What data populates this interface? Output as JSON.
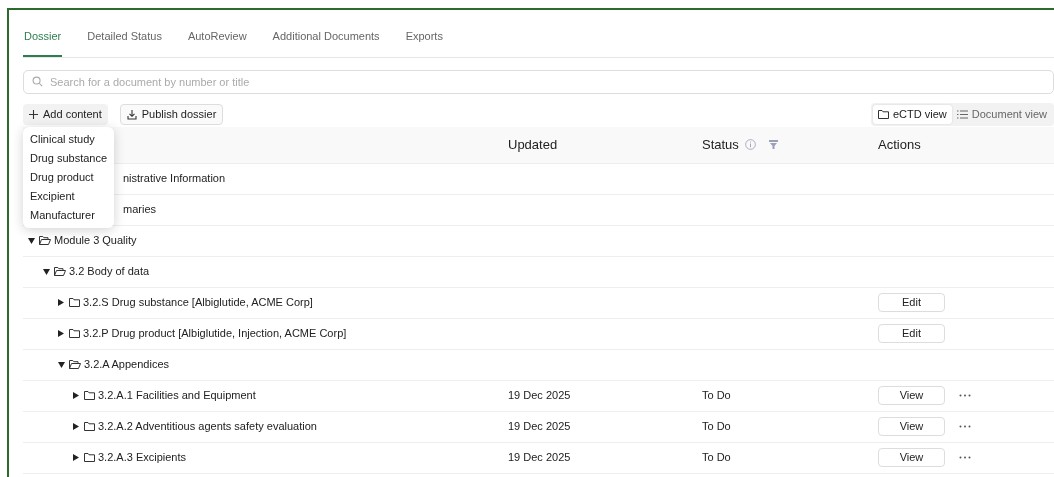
{
  "tabs": [
    {
      "label": "Dossier",
      "selected": true
    },
    {
      "label": "Detailed Status",
      "selected": false
    },
    {
      "label": "AutoReview",
      "selected": false
    },
    {
      "label": "Additional Documents",
      "selected": false
    },
    {
      "label": "Exports",
      "selected": false
    }
  ],
  "search": {
    "placeholder": "Search for a document by number or title"
  },
  "toolbar": {
    "add_button": "Add content",
    "publish_button": "Publish dossier",
    "views": [
      {
        "label": "eCTD view",
        "kind": "folder",
        "selected": true
      },
      {
        "label": "Document view",
        "kind": "list",
        "selected": false
      }
    ]
  },
  "add_menu": {
    "items": [
      "Clinical study",
      "Drug substance",
      "Drug product",
      "Excipient",
      "Manufacturer"
    ]
  },
  "table": {
    "columns": [
      "Updated",
      "Status",
      "Actions"
    ],
    "rows": [
      {
        "kind": "covered",
        "name": "nistrative Information"
      },
      {
        "kind": "covered",
        "name": "maries"
      },
      {
        "kind": "folder",
        "name": "Module 3 Quality",
        "expanded": true,
        "children": [
          {
            "kind": "folder",
            "name": "3.2 Body of data",
            "expanded": true,
            "children": [
              {
                "kind": "folder",
                "name": "3.2.S Drug substance [Albiglutide, ACME Corp]",
                "expanded": false,
                "action": "Edit"
              },
              {
                "kind": "folder",
                "name": "3.2.P Drug product [Albiglutide, Injection, ACME Corp]",
                "expanded": false,
                "action": "Edit"
              },
              {
                "kind": "folder",
                "name": "3.2.A Appendices",
                "expanded": true,
                "children": [
                  {
                    "kind": "folder",
                    "name": "3.2.A.1 Facilities and Equipment",
                    "expanded": false,
                    "updated": "19 Dec 2025",
                    "status": "To Do",
                    "action": "View",
                    "more": true
                  },
                  {
                    "kind": "folder",
                    "name": "3.2.A.2 Adventitious agents safety evaluation",
                    "expanded": false,
                    "updated": "19 Dec 2025",
                    "status": "To Do",
                    "action": "View",
                    "more": true
                  },
                  {
                    "kind": "folder",
                    "name": "3.2.A.3 Excipients",
                    "expanded": false,
                    "updated": "19 Dec 2025",
                    "status": "To Do",
                    "action": "View",
                    "more": true
                  }
                ]
              }
            ]
          }
        ]
      }
    ]
  }
}
